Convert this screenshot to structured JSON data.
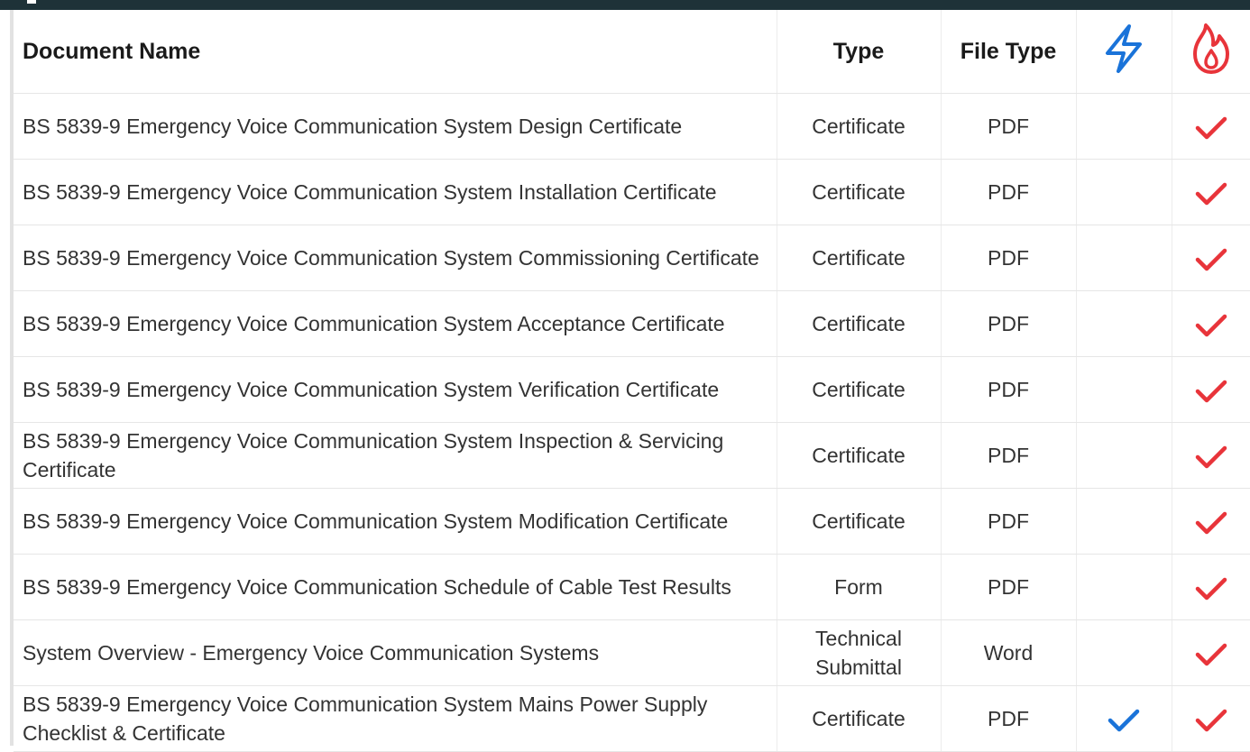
{
  "table": {
    "headers": {
      "name": "Document Name",
      "type": "Type",
      "file_type": "File Type",
      "electrical_icon": "lightning-icon",
      "fire_icon": "flame-icon"
    },
    "rows": [
      {
        "name": "BS 5839-9 Emergency Voice Communication System Design Certificate",
        "type": "Certificate",
        "file_type": "PDF",
        "electrical": false,
        "fire": true
      },
      {
        "name": "BS 5839-9 Emergency Voice Communication System Installation Certificate",
        "type": "Certificate",
        "file_type": "PDF",
        "electrical": false,
        "fire": true
      },
      {
        "name": "BS 5839-9 Emergency Voice Communication System Commissioning Certificate",
        "type": "Certificate",
        "file_type": "PDF",
        "electrical": false,
        "fire": true
      },
      {
        "name": "BS 5839-9 Emergency Voice Communication System Acceptance Certificate",
        "type": "Certificate",
        "file_type": "PDF",
        "electrical": false,
        "fire": true
      },
      {
        "name": "BS 5839-9 Emergency Voice Communication System Verification Certificate",
        "type": "Certificate",
        "file_type": "PDF",
        "electrical": false,
        "fire": true
      },
      {
        "name": "BS 5839-9 Emergency Voice Communication System Inspection & Servicing Certificate",
        "type": "Certificate",
        "file_type": "PDF",
        "electrical": false,
        "fire": true
      },
      {
        "name": "BS 5839-9 Emergency Voice Communication System Modification Certificate",
        "type": "Certificate",
        "file_type": "PDF",
        "electrical": false,
        "fire": true
      },
      {
        "name": "BS 5839-9 Emergency Voice Communication Schedule of Cable Test Results",
        "type": "Form",
        "file_type": "PDF",
        "electrical": false,
        "fire": true
      },
      {
        "name": "System Overview - Emergency Voice Communication Systems",
        "type": "Technical Submittal",
        "file_type": "Word",
        "electrical": false,
        "fire": true
      },
      {
        "name": "BS 5839-9 Emergency Voice Communication System Mains Power Supply Checklist & Certificate",
        "type": "Certificate",
        "file_type": "PDF",
        "electrical": true,
        "fire": true
      }
    ]
  },
  "colors": {
    "electrical": "#1a73d9",
    "fire": "#e8343a",
    "header_bar": "#1e3238"
  }
}
